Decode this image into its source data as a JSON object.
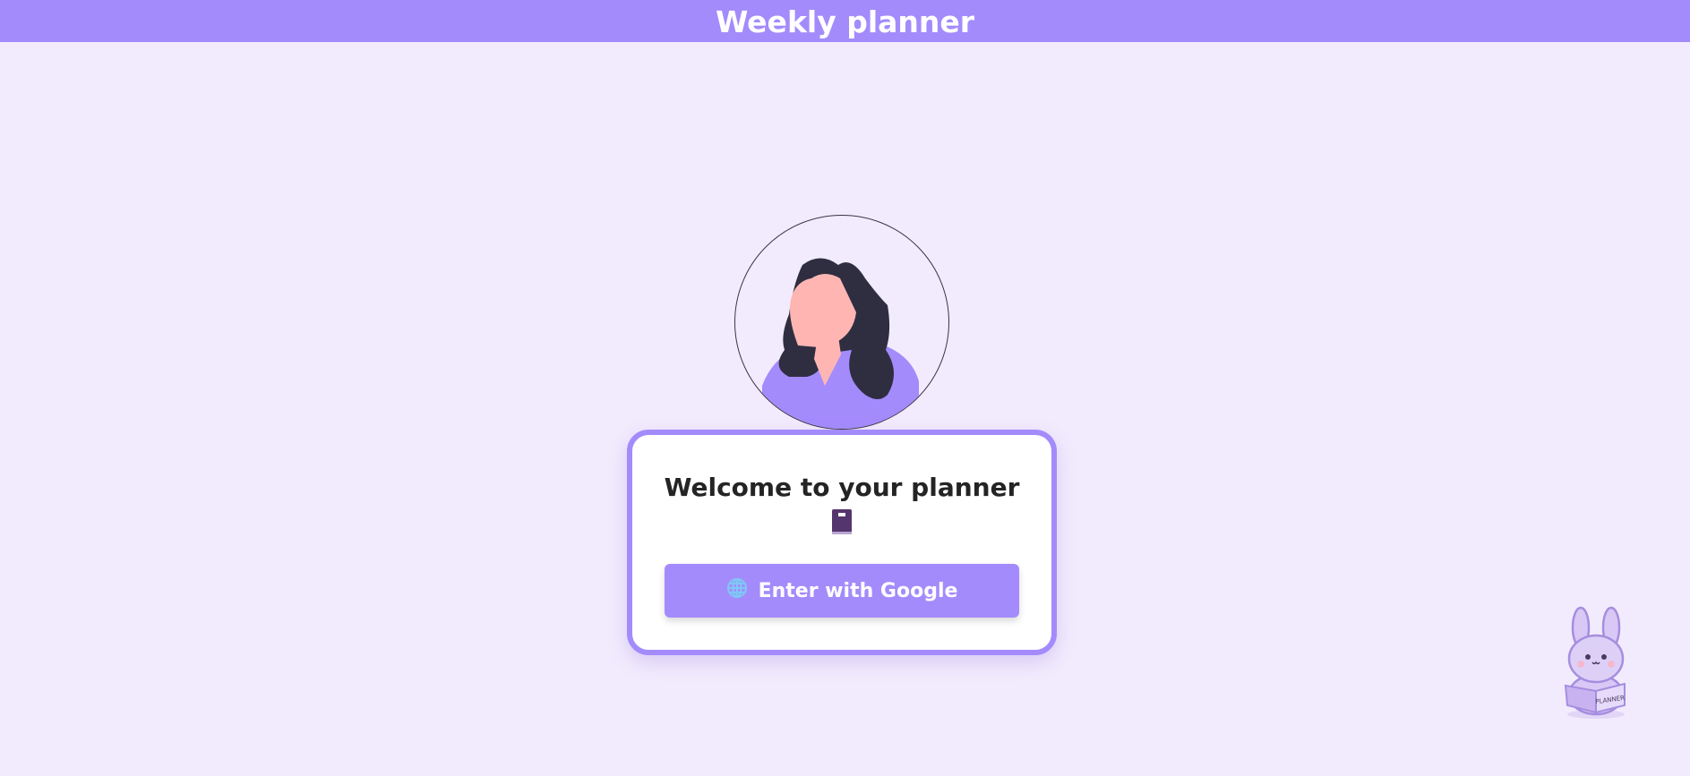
{
  "header": {
    "title": "Weekly planner"
  },
  "card": {
    "title": "Welcome to your planner",
    "title_icon": "notebook-icon",
    "button_label": "Enter with Google",
    "button_icon": "globe-icon"
  },
  "mascot": {
    "book_label": "PLANNER"
  },
  "colors": {
    "accent": "#a48bfc",
    "background": "#f2ebfd",
    "hair": "#2f2e41",
    "skin": "#ffb6b3"
  }
}
